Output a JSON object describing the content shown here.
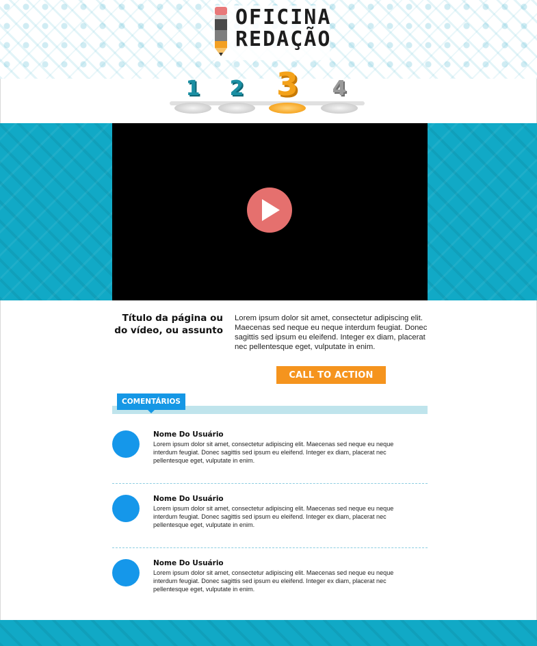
{
  "header": {
    "logo_line1": "OFICINA",
    "logo_line2": "REDAÇÃO",
    "steps": [
      "1",
      "2",
      "3",
      "4"
    ],
    "active_step": 3
  },
  "video": {
    "play_icon": "play-icon"
  },
  "content": {
    "title": "Título da página ou do vídeo, ou assunto",
    "description": "Lorem ipsum dolor sit amet, consectetur adipiscing elit. Maecenas sed neque eu neque interdum feugiat. Donec sagittis sed ipsum eu eleifend. Integer ex diam, placerat nec pellentesque eget, vulputate in enim.",
    "cta_label": "CALL TO ACTION"
  },
  "comments": {
    "tab_label": "COMENTÁRIOS",
    "items": [
      {
        "name": "Nome Do Usuário",
        "text": "Lorem ipsum dolor sit amet, consectetur adipiscing elit. Maecenas sed neque eu neque interdum feugiat. Donec sagittis sed ipsum eu eleifend. Integer ex diam, placerat nec pellentesque eget, vulputate in enim."
      },
      {
        "name": "Nome Do Usuário",
        "text": "Lorem ipsum dolor sit amet, consectetur adipiscing elit. Maecenas sed neque eu neque interdum feugiat. Donec sagittis sed ipsum eu eleifend. Integer ex diam, placerat nec pellentesque eget, vulputate in enim."
      },
      {
        "name": "Nome Do Usuário",
        "text": "Lorem ipsum dolor sit amet, consectetur adipiscing elit. Maecenas sed neque eu neque interdum feugiat. Donec sagittis sed ipsum eu eleifend. Integer ex diam, placerat nec pellentesque eget, vulputate in enim."
      }
    ]
  },
  "colors": {
    "accent_teal": "#11a9c6",
    "cta_orange": "#f5941e",
    "comments_blue": "#1597e5",
    "play_button": "#e5706e"
  }
}
